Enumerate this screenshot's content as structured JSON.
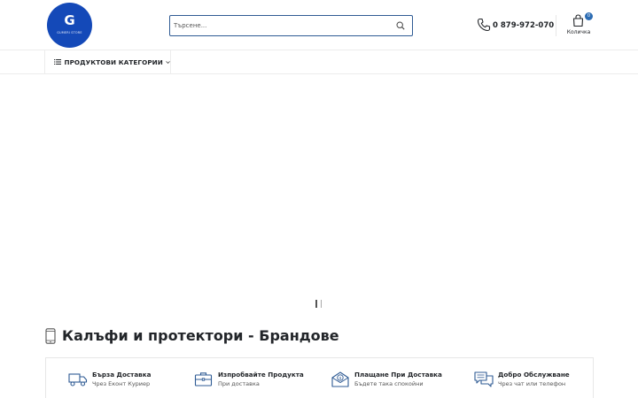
{
  "brand": {
    "logo_letter": "G",
    "logo_text": "GUMERI STORE",
    "logo_color": "#1449b8"
  },
  "search": {
    "placeholder": "Търсене...",
    "value": "",
    "button_icon": "search-icon"
  },
  "contact": {
    "phone": "0 879-972-070",
    "icon": "phone-icon"
  },
  "cart": {
    "label": "Количка",
    "count": "0",
    "icon": "shopping-bag-icon",
    "badge_color": "#2c6cb3"
  },
  "nav": {
    "categories_label": "ПРОДУКТОВИ КАТЕГОРИИ"
  },
  "slider": {
    "dots": 2,
    "active_index": 0
  },
  "section": {
    "title": "Калъфи и протектори - Брандове",
    "icon": "mobile-phone-icon"
  },
  "info": [
    {
      "icon": "delivery-truck-icon",
      "title": "Бърза Доставка",
      "subtitle": "Чрез Еконт Куриер"
    },
    {
      "icon": "briefcase-icon",
      "title": "Изпробвайте Продукта",
      "subtitle": "При доставка"
    },
    {
      "icon": "money-envelope-icon",
      "title": "Плащане При Доставка",
      "subtitle": "Бъдете така спокойни"
    },
    {
      "icon": "chat-bubbles-icon",
      "title": "Добро Обслужване",
      "subtitle": "Чрез чат или телефон"
    }
  ]
}
